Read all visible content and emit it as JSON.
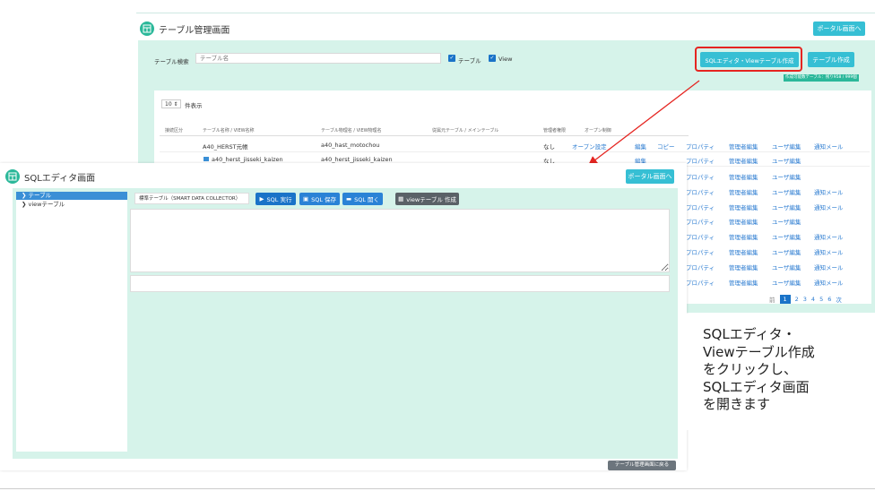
{
  "table_screen": {
    "title": "テーブル管理画面",
    "portal_button": "ポータル画面へ",
    "search_label": "テーブル検索",
    "search_placeholder": "テーブル名",
    "check_table": "テーブル",
    "check_view": "View",
    "sql_editor_button": "SQLエディタ・Viewテーブル作成",
    "create_table_button": "テーブル作成",
    "quota_badge": "作成可能数テーブル：残り958 / 999個",
    "page_size": "10",
    "page_size_suffix": "件表示",
    "columns": [
      "接続区分",
      "テーブル名称 / VIEW名称",
      "テーブル物理名 / VIEW物理名",
      "従属元テーブル / メインテーブル",
      "管理者権限",
      "オープン制御"
    ],
    "rows": [
      {
        "name": "A40_HERST元帳",
        "physical": "a40_hast_motochou",
        "admin": "なし",
        "open": "オープン設定",
        "edit": "編集",
        "copy": "コピー",
        "prop": "プロパティ",
        "admin_edit": "管理者編集",
        "user_edit": "ユーザ編集",
        "notify": "通知メール"
      },
      {
        "name": "a40_herst_jisseki_kaizen",
        "physical": "a40_herst_jisseki_kaizen",
        "admin": "なし",
        "open": "",
        "edit": "編集",
        "copy": "",
        "prop": "プロパティ",
        "admin_edit": "管理者編集",
        "user_edit": "ユーザ編集",
        "notify": ""
      }
    ],
    "extra_rows": [
      {
        "prop": "プロパティ",
        "admin_edit": "管理者編集",
        "user_edit": "ユーザ編集",
        "notify": ""
      },
      {
        "prop": "プロパティ",
        "admin_edit": "管理者編集",
        "user_edit": "ユーザ編集",
        "notify": "通知メール"
      },
      {
        "prop": "プロパティ",
        "admin_edit": "管理者編集",
        "user_edit": "ユーザ編集",
        "notify": "通知メール"
      },
      {
        "prop": "プロパティ",
        "admin_edit": "管理者編集",
        "user_edit": "ユーザ編集",
        "notify": ""
      },
      {
        "prop": "プロパティ",
        "admin_edit": "管理者編集",
        "user_edit": "ユーザ編集",
        "notify": "通知メール"
      },
      {
        "prop": "プロパティ",
        "admin_edit": "管理者編集",
        "user_edit": "ユーザ編集",
        "notify": "通知メール"
      },
      {
        "prop": "プロパティ",
        "admin_edit": "管理者編集",
        "user_edit": "ユーザ編集",
        "notify": "通知メール"
      },
      {
        "prop": "プロパティ",
        "admin_edit": "管理者編集",
        "user_edit": "ユーザ編集",
        "notify": "通知メール"
      }
    ],
    "pagination": {
      "prev": "前",
      "pages": [
        "1",
        "2",
        "3",
        "4",
        "5",
        "6"
      ],
      "next": "次",
      "current": "1"
    }
  },
  "sql_screen": {
    "title": "SQLエディタ画面",
    "portal_button": "ポータル画面へ",
    "tree": [
      {
        "label": "テーブル",
        "selected": true
      },
      {
        "label": "viewテーブル",
        "selected": false
      }
    ],
    "db_select": "標準テーブル（SMART DATA COLLECTOR）",
    "run_button": "SQL 実行",
    "save_button": "SQL 保存",
    "open_button": "SQL 開く",
    "view_button": "viewテーブル 作成",
    "back_button": "テーブル管理画面に戻る"
  },
  "callout": {
    "lines": [
      "SQLエディタ・",
      "Viewテーブル作成",
      "をクリックし、",
      "SQLエディタ画面",
      "を開きます"
    ]
  },
  "colors": {
    "mint": "#d6f3ea",
    "teal": "#36bfd4",
    "brand": "#2bb89a",
    "highlight": "#e52521",
    "link": "#2a7bd1",
    "dark_button": "#6c757d",
    "blue_button": "#1a73c8"
  }
}
